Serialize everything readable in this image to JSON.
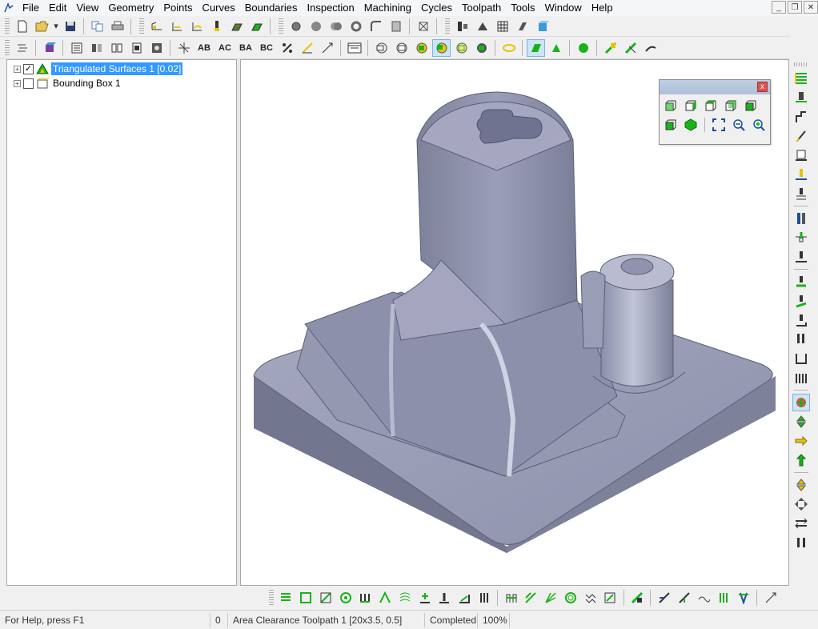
{
  "menu": {
    "items": [
      "File",
      "Edit",
      "View",
      "Geometry",
      "Points",
      "Curves",
      "Boundaries",
      "Inspection",
      "Machining",
      "Cycles",
      "Toolpath",
      "Tools",
      "Window",
      "Help"
    ]
  },
  "toolbar2": {
    "text_buttons": [
      "AB",
      "AC",
      "BA",
      "BC"
    ]
  },
  "tree": {
    "items": [
      {
        "label": "Triangulated Surfaces 1 [0.02]",
        "checked": true,
        "expander": "+",
        "check_mark": "✓"
      },
      {
        "label": "Bounding Box 1",
        "checked": false,
        "expander": "+",
        "check_mark": ""
      }
    ]
  },
  "view_palette": {
    "close_label": "x"
  },
  "status": {
    "help": "For Help, press F1",
    "count": "0",
    "toolpath": "Area Clearance Toolpath 1 [20x3.5, 0.5]",
    "state": "Completed",
    "percent": "100%"
  },
  "colors": {
    "model_face": "#8f93ad",
    "model_light": "#b3b6cc",
    "model_dark": "#6b6f89",
    "selection": "#3399ff",
    "accent_green": "#19b319",
    "accent_yellow": "#e8c400"
  }
}
